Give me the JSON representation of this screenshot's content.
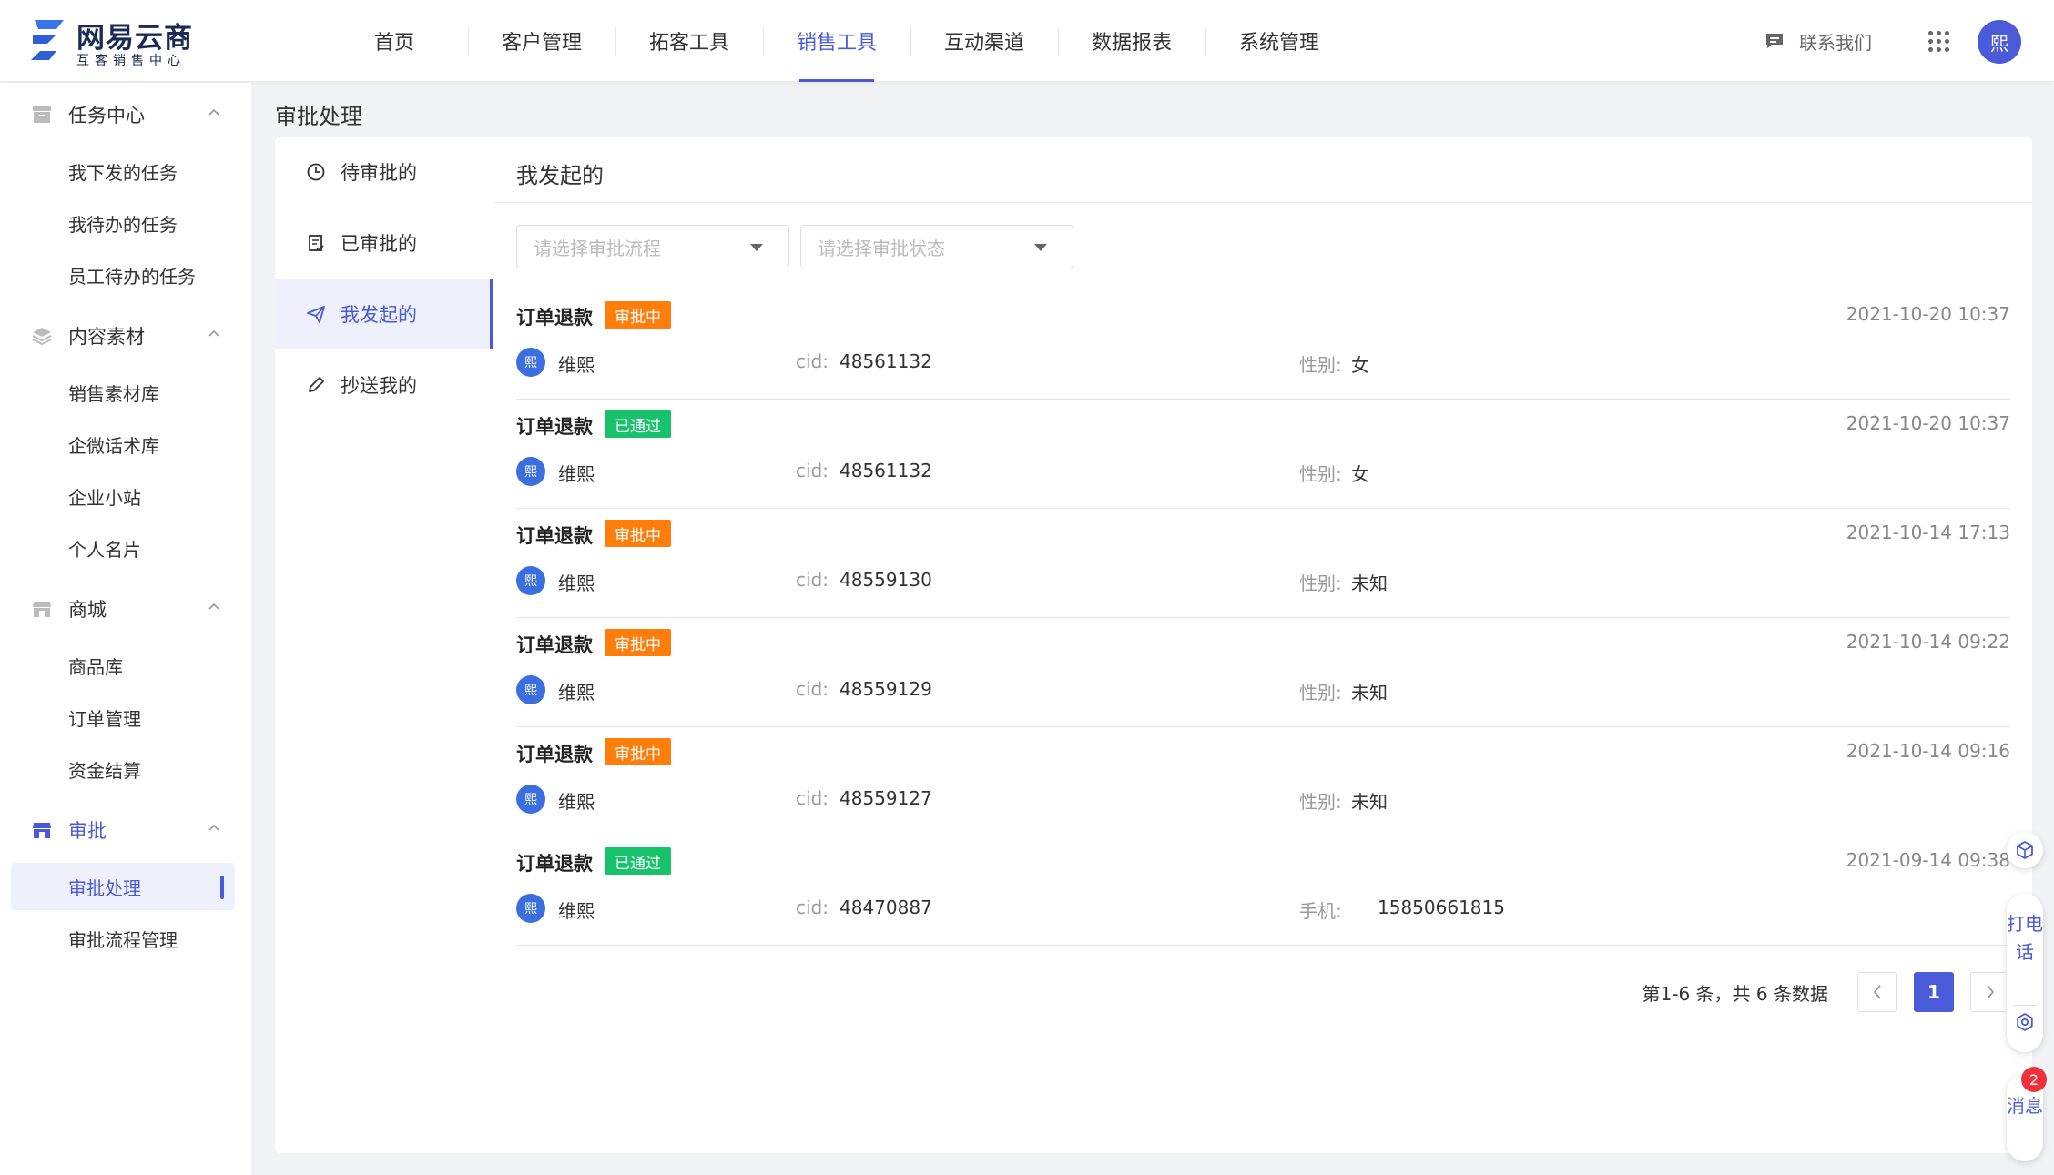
{
  "brand": {
    "name": "网易云商",
    "subtitle": "互客销售中心",
    "accent_color": "#4a5ad8"
  },
  "topnav": {
    "items": [
      {
        "label": "首页",
        "active": false
      },
      {
        "label": "客户管理",
        "active": false
      },
      {
        "label": "拓客工具",
        "active": false
      },
      {
        "label": "销售工具",
        "active": true
      },
      {
        "label": "互动渠道",
        "active": false
      },
      {
        "label": "数据报表",
        "active": false
      },
      {
        "label": "系统管理",
        "active": false
      }
    ],
    "contact_label": "联系我们",
    "contact_icon": "chat-bubble-icon",
    "apps_icon": "grid-apps-icon",
    "avatar_text": "熙"
  },
  "sidebar": {
    "groups": [
      {
        "label": "任务中心",
        "icon": "archive-icon",
        "expanded": true,
        "items": [
          {
            "label": "我下发的任务"
          },
          {
            "label": "我待办的任务"
          },
          {
            "label": "员工待办的任务"
          }
        ]
      },
      {
        "label": "内容素材",
        "icon": "layers-icon",
        "expanded": true,
        "items": [
          {
            "label": "销售素材库"
          },
          {
            "label": "企微话术库"
          },
          {
            "label": "企业小站"
          },
          {
            "label": "个人名片"
          }
        ]
      },
      {
        "label": "商城",
        "icon": "store-icon",
        "expanded": true,
        "items": [
          {
            "label": "商品库"
          },
          {
            "label": "订单管理"
          },
          {
            "label": "资金结算"
          }
        ]
      },
      {
        "label": "审批",
        "icon": "approval-shop-icon",
        "expanded": true,
        "active": true,
        "items": [
          {
            "label": "审批处理",
            "active": true
          },
          {
            "label": "审批流程管理"
          }
        ]
      }
    ]
  },
  "page": {
    "title": "审批处理",
    "subnav": [
      {
        "label": "待审批的",
        "icon": "clock-icon"
      },
      {
        "label": "已审批的",
        "icon": "document-check-icon"
      },
      {
        "label": "我发起的",
        "icon": "paper-plane-icon",
        "active": true
      },
      {
        "label": "抄送我的",
        "icon": "pencil-icon"
      }
    ],
    "content_title": "我发起的",
    "filters": {
      "process_placeholder": "请选择审批流程",
      "status_placeholder": "请选择审批状态"
    },
    "records": [
      {
        "title": "订单退款",
        "status": "审批中",
        "status_type": "pending",
        "time": "2021-10-20 10:37",
        "avatar": "熙",
        "user": "维熙",
        "cid_label": "cid:",
        "cid": "48561132",
        "extra_label": "性别:",
        "extra_value": "女"
      },
      {
        "title": "订单退款",
        "status": "已通过",
        "status_type": "passed",
        "time": "2021-10-20 10:37",
        "avatar": "熙",
        "user": "维熙",
        "cid_label": "cid:",
        "cid": "48561132",
        "extra_label": "性别:",
        "extra_value": "女"
      },
      {
        "title": "订单退款",
        "status": "审批中",
        "status_type": "pending",
        "time": "2021-10-14 17:13",
        "avatar": "熙",
        "user": "维熙",
        "cid_label": "cid:",
        "cid": "48559130",
        "extra_label": "性别:",
        "extra_value": "未知"
      },
      {
        "title": "订单退款",
        "status": "审批中",
        "status_type": "pending",
        "time": "2021-10-14 09:22",
        "avatar": "熙",
        "user": "维熙",
        "cid_label": "cid:",
        "cid": "48559129",
        "extra_label": "性别:",
        "extra_value": "未知"
      },
      {
        "title": "订单退款",
        "status": "审批中",
        "status_type": "pending",
        "time": "2021-10-14 09:16",
        "avatar": "熙",
        "user": "维熙",
        "cid_label": "cid:",
        "cid": "48559127",
        "extra_label": "性别:",
        "extra_value": "未知"
      },
      {
        "title": "订单退款",
        "status": "已通过",
        "status_type": "passed",
        "time": "2021-09-14 09:38",
        "avatar": "熙",
        "user": "维熙",
        "cid_label": "cid:",
        "cid": "48470887",
        "extra_label": "手机:",
        "extra_value": "15850661815"
      }
    ],
    "pagination": {
      "summary": "第1-6 条，共 6 条数据",
      "current_page": "1",
      "prev_icon": "chevron-left-icon",
      "next_icon": "chevron-right-icon"
    },
    "status_colors": {
      "pending": "#ff7d0a",
      "passed": "#17c26b"
    }
  },
  "floating": {
    "call_label": "打电话",
    "message_label": "消息",
    "message_count": "2"
  }
}
